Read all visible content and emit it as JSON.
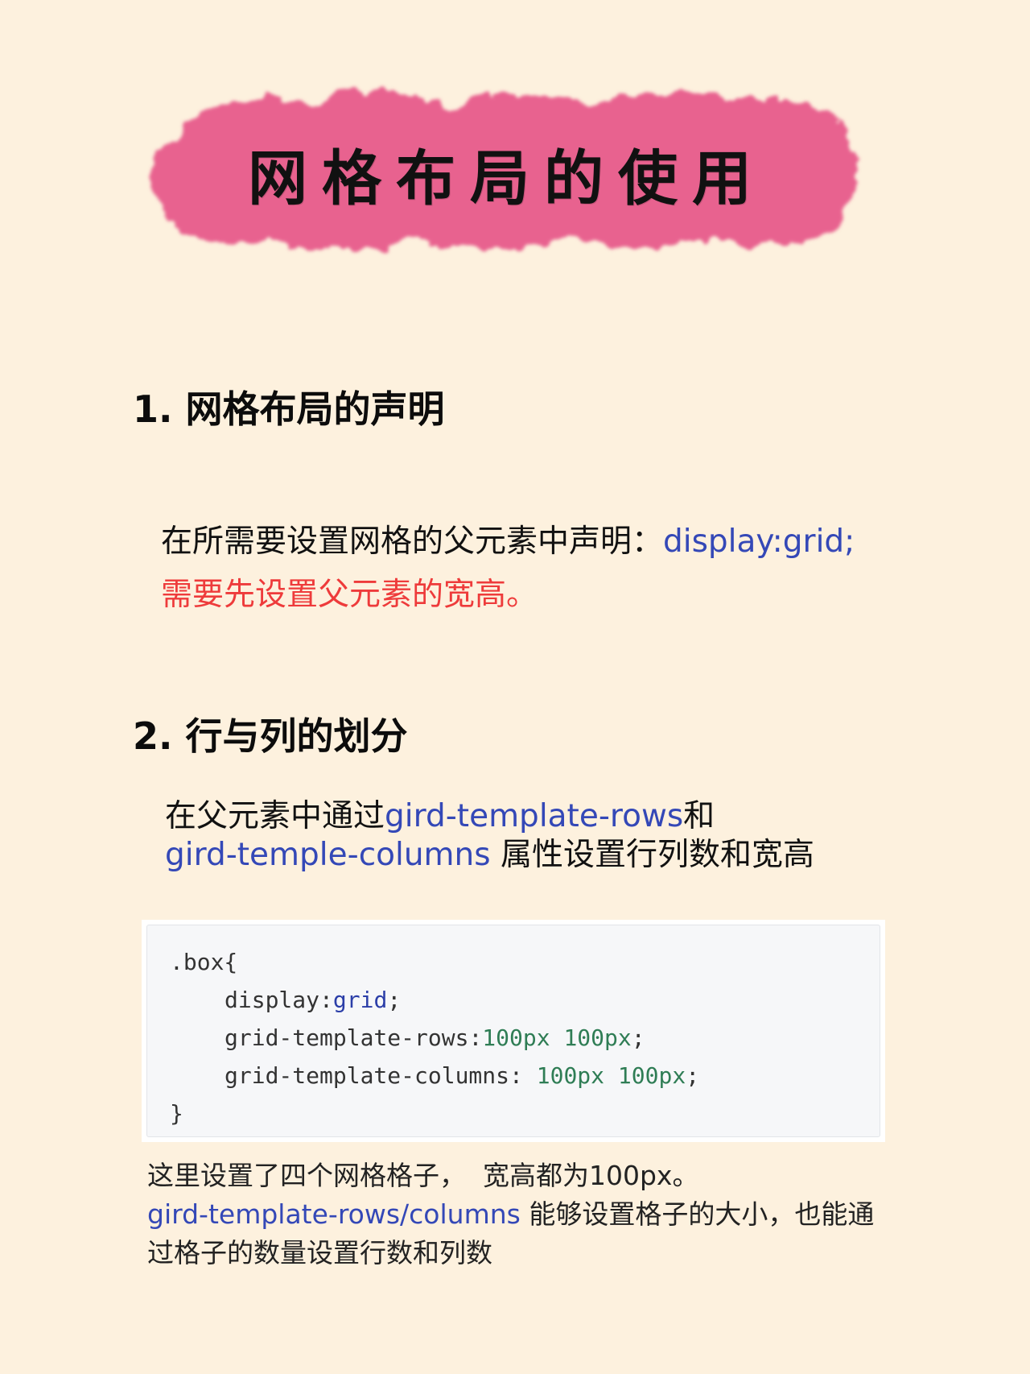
{
  "banner": {
    "title": "网格布局的使用",
    "color": "#e8628f"
  },
  "sections": [
    {
      "heading": "1. 网格布局的声明",
      "text_before": "在所需要设置网格的父元素中声明：",
      "keyword": "display:grid;",
      "warning": "需要先设置父元素的宽高。"
    },
    {
      "heading": "2. 行与列的划分",
      "line1_text": "在父元素中通过",
      "line1_keyword": "gird-template-rows",
      "line1_suffix": "和",
      "line2_keyword": "gird-temple-columns",
      "line2_text": " 属性设置行列数和宽高"
    }
  ],
  "code": {
    "line1": ".box{",
    "line2_prop": "display",
    "line2_colon": ":",
    "line2_value": "grid",
    "line2_semi": ";",
    "line3_prop": "grid-template-rows",
    "line3_colon": ":",
    "line3_v1": "100px",
    "line3_v2": "100px",
    "line3_semi": ";",
    "line4_prop": "grid-template-columns",
    "line4_colon": ": ",
    "line4_v1": "100px",
    "line4_v2": "100px",
    "line4_semi": ";",
    "line5": "}"
  },
  "note": {
    "line1": "这里设置了四个网格格子，  宽高都为100px。",
    "line2_keyword": "gird-template-rows/columns",
    "line2_text": " 能够设置格子的大小，也能通",
    "line3": "过格子的数量设置行数和列数"
  },
  "colors": {
    "background": "#fdf1de",
    "keyword_blue": "#3448b7",
    "warning_red": "#ee3b3b",
    "number_green": "#2f7d55"
  }
}
